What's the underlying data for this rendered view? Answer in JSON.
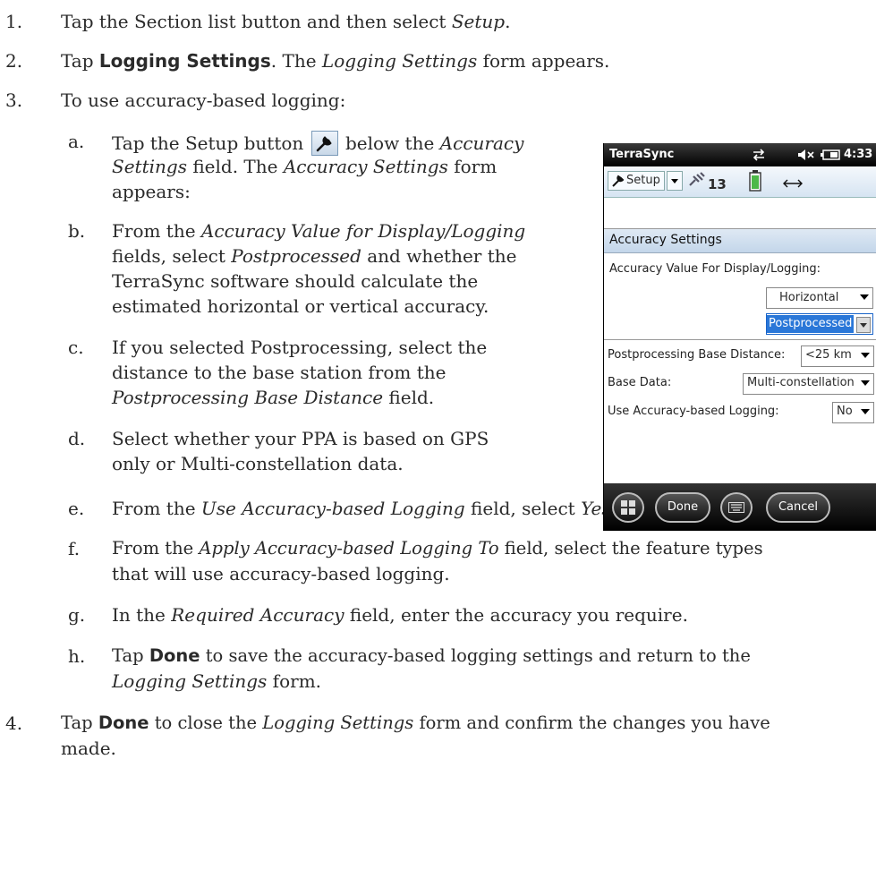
{
  "steps": {
    "s1": {
      "num": "1.",
      "a": "Tap the Section list button and then select ",
      "b": "Setup",
      "c": "."
    },
    "s2": {
      "num": "2.",
      "a": "Tap ",
      "b": "Logging Settings",
      "c": ". The ",
      "d": "Logging Settings",
      "e": " form appears."
    },
    "s3": {
      "num": "3.",
      "a": "To use accuracy-based logging:"
    },
    "sa": {
      "num": "a.",
      "l1a": "Tap the Setup button ",
      "l1b": " below the ",
      "l1c": "Accuracy",
      "l2a": "Settings",
      "l2b": " field. The ",
      "l2c": "Accuracy Settings",
      "l2d": " form",
      "l3": "appears:"
    },
    "sb": {
      "num": "b.",
      "l1a": "From the ",
      "l1b": "Accuracy Value for Display/Logging",
      "l2a": "fields, select ",
      "l2b": "Postprocessed",
      "l2c": " and whether the",
      "l3": "TerraSync software should calculate the",
      "l4": "estimated horizontal or vertical accuracy."
    },
    "sc": {
      "num": "c.",
      "l1": "If you selected Postprocessing, select the",
      "l2": "distance to the base station from the",
      "l3a": "Postprocessing Base Distance",
      "l3b": " field."
    },
    "sd": {
      "num": "d.",
      "l1": "Select whether your PPA is based on GPS",
      "l2": "only or Multi-constellation data."
    },
    "se": {
      "num": "e.",
      "a": "From the ",
      "b": "Use Accuracy-based Logging",
      "c": " field, select ",
      "d": "Yes",
      "e": "."
    },
    "sf": {
      "num": "f.",
      "l1a": "From the ",
      "l1b": "Apply Accuracy-based Logging To",
      "l1c": " field, select the feature types",
      "l2": "that will use accuracy-based logging."
    },
    "sg": {
      "num": "g.",
      "a": "In the ",
      "b": "Required Accuracy",
      "c": " field, enter the accuracy you require."
    },
    "sh": {
      "num": "h.",
      "l1a": "Tap ",
      "l1b": "Done",
      "l1c": " to save the accuracy-based logging settings and return to the",
      "l2a": "Logging Settings",
      "l2b": " form."
    },
    "s4": {
      "num": "4.",
      "l1a": "Tap ",
      "l1b": "Done",
      "l1c": " to close the ",
      "l1d": "Logging Settings",
      "l1e": " form and confirm the changes you have",
      "l2": "made."
    }
  },
  "device": {
    "app_name": "TerraSync",
    "time": "4:33",
    "section_button": "Setup",
    "satellite_count": "13",
    "form_title": "Accuracy Settings",
    "accuracy_value_label": "Accuracy Value For Display/Logging:",
    "accuracy_dimension": "Horizontal",
    "accuracy_type": "Postprocessed",
    "base_distance_label": "Postprocessing Base Distance:",
    "base_distance_value": "<25 km",
    "base_data_label": "Base Data:",
    "base_data_value": "Multi-constellation",
    "use_logging_label": "Use Accuracy-based Logging:",
    "use_logging_value": "No",
    "done_button": "Done",
    "cancel_button": "Cancel",
    "icons": [
      "sync-icon",
      "speaker-mute-icon",
      "battery-icon",
      "wrench-icon",
      "satellite-icon",
      "battery-level-icon",
      "arrows-icon",
      "windows-start-icon",
      "keyboard-icon"
    ]
  }
}
